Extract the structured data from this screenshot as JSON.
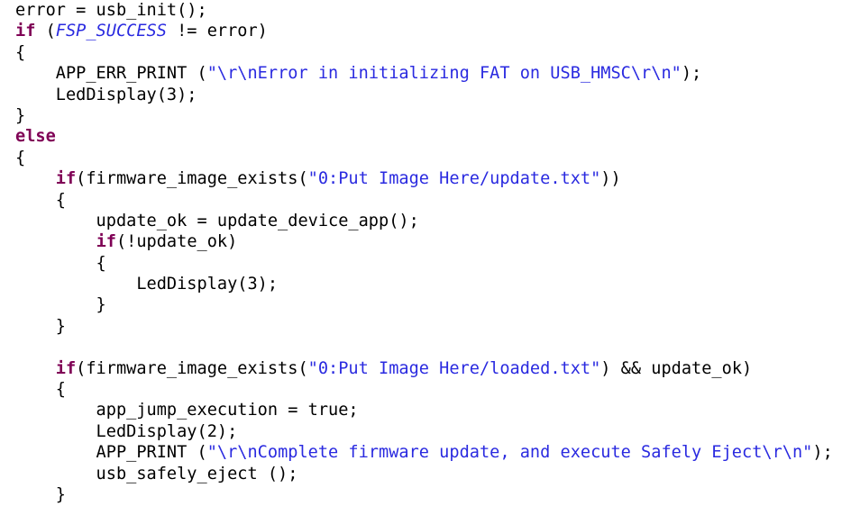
{
  "document": {
    "kind": "source-code-listing",
    "language": "C",
    "background_color": "#ffffff",
    "colors": {
      "plain": "#000000",
      "keyword": "#7f0055",
      "string": "#2a2ae0",
      "macro_constant": "#2a2ae0"
    },
    "lines": [
      {
        "index": 1,
        "text": "error = usb_init();",
        "tokens": [
          {
            "t": "error = usb_init();",
            "c": "plain"
          }
        ]
      },
      {
        "index": 2,
        "text": "if (FSP_SUCCESS != error)",
        "tokens": [
          {
            "t": "if",
            "c": "keyword"
          },
          {
            "t": " (",
            "c": "plain"
          },
          {
            "t": "FSP_SUCCESS",
            "c": "macro"
          },
          {
            "t": " != error)",
            "c": "plain"
          }
        ]
      },
      {
        "index": 3,
        "text": "{",
        "tokens": [
          {
            "t": "{",
            "c": "plain"
          }
        ]
      },
      {
        "index": 4,
        "text": "    APP_ERR_PRINT (\"\\r\\nError in initializing FAT on USB_HMSC\\r\\n\");",
        "tokens": [
          {
            "t": "    APP_ERR_PRINT (",
            "c": "plain"
          },
          {
            "t": "\"\\r\\nError in initializing FAT on USB_HMSC\\r\\n\"",
            "c": "string"
          },
          {
            "t": ");",
            "c": "plain"
          }
        ]
      },
      {
        "index": 5,
        "text": "    LedDisplay(3);",
        "tokens": [
          {
            "t": "    LedDisplay(3);",
            "c": "plain"
          }
        ]
      },
      {
        "index": 6,
        "text": "}",
        "tokens": [
          {
            "t": "}",
            "c": "plain"
          }
        ]
      },
      {
        "index": 7,
        "text": "else",
        "tokens": [
          {
            "t": "else",
            "c": "keyword"
          }
        ]
      },
      {
        "index": 8,
        "text": "{",
        "tokens": [
          {
            "t": "{",
            "c": "plain"
          }
        ]
      },
      {
        "index": 9,
        "text": "    if(firmware_image_exists(\"0:Put Image Here/update.txt\"))",
        "tokens": [
          {
            "t": "    ",
            "c": "plain"
          },
          {
            "t": "if",
            "c": "keyword"
          },
          {
            "t": "(firmware_image_exists(",
            "c": "plain"
          },
          {
            "t": "\"0:Put Image Here/update.txt\"",
            "c": "string"
          },
          {
            "t": "))",
            "c": "plain"
          }
        ]
      },
      {
        "index": 10,
        "text": "    {",
        "tokens": [
          {
            "t": "    {",
            "c": "plain"
          }
        ]
      },
      {
        "index": 11,
        "text": "        update_ok = update_device_app();",
        "tokens": [
          {
            "t": "        update_ok = update_device_app();",
            "c": "plain"
          }
        ]
      },
      {
        "index": 12,
        "text": "        if(!update_ok)",
        "tokens": [
          {
            "t": "        ",
            "c": "plain"
          },
          {
            "t": "if",
            "c": "keyword"
          },
          {
            "t": "(!update_ok)",
            "c": "plain"
          }
        ]
      },
      {
        "index": 13,
        "text": "        {",
        "tokens": [
          {
            "t": "        {",
            "c": "plain"
          }
        ]
      },
      {
        "index": 14,
        "text": "            LedDisplay(3);",
        "tokens": [
          {
            "t": "            LedDisplay(3);",
            "c": "plain"
          }
        ]
      },
      {
        "index": 15,
        "text": "        }",
        "tokens": [
          {
            "t": "        }",
            "c": "plain"
          }
        ]
      },
      {
        "index": 16,
        "text": "    }",
        "tokens": [
          {
            "t": "    }",
            "c": "plain"
          }
        ]
      },
      {
        "index": 17,
        "text": "",
        "tokens": [
          {
            "t": " ",
            "c": "blank"
          }
        ]
      },
      {
        "index": 18,
        "text": "    if(firmware_image_exists(\"0:Put Image Here/loaded.txt\") && update_ok)",
        "tokens": [
          {
            "t": "    ",
            "c": "plain"
          },
          {
            "t": "if",
            "c": "keyword"
          },
          {
            "t": "(firmware_image_exists(",
            "c": "plain"
          },
          {
            "t": "\"0:Put Image Here/loaded.txt\"",
            "c": "string"
          },
          {
            "t": ") && update_ok)",
            "c": "plain"
          }
        ]
      },
      {
        "index": 19,
        "text": "    {",
        "tokens": [
          {
            "t": "    {",
            "c": "plain"
          }
        ]
      },
      {
        "index": 20,
        "text": "        app_jump_execution = true;",
        "tokens": [
          {
            "t": "        app_jump_execution = true;",
            "c": "plain"
          }
        ]
      },
      {
        "index": 21,
        "text": "        LedDisplay(2);",
        "tokens": [
          {
            "t": "        LedDisplay(2);",
            "c": "plain"
          }
        ]
      },
      {
        "index": 22,
        "text": "        APP_PRINT (\"\\r\\nComplete firmware update, and execute Safely Eject\\r\\n\");",
        "tokens": [
          {
            "t": "        APP_PRINT (",
            "c": "plain"
          },
          {
            "t": "\"\\r\\nComplete firmware update, and execute Safely Eject\\r\\n\"",
            "c": "string"
          },
          {
            "t": ");",
            "c": "plain"
          }
        ]
      },
      {
        "index": 23,
        "text": "        usb_safely_eject ();",
        "tokens": [
          {
            "t": "        usb_safely_eject ();",
            "c": "plain"
          }
        ]
      },
      {
        "index": 24,
        "text": "    }",
        "tokens": [
          {
            "t": "    }",
            "c": "plain"
          }
        ]
      }
    ]
  }
}
